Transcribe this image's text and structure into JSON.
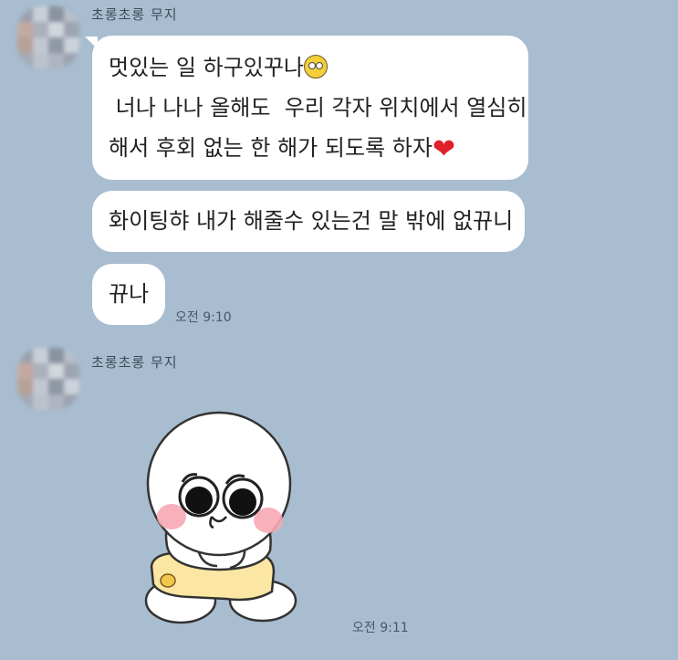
{
  "messages": {
    "group1": {
      "sender": "초롱초롱 무지",
      "bubble1_lines": [
        "멋있는 일 하구있꾸나",
        " 너나 나나 올해도  우리 각자 위치에서 열심히",
        "해서 후회 없는 한 해가 되도록 하자"
      ],
      "bubble2": "화이팅햐 내가 해줄수 있는건 말 밖에 없뀨니",
      "bubble3": "뀨나",
      "time": "오전 9:10"
    },
    "group2": {
      "sender": "초롱초롱 무지",
      "time": "오전 9:11"
    }
  },
  "icons": {
    "emoji1": "muzi-face-emoticon",
    "emoji2": "red-heart",
    "sticker": "white-character-sticker"
  },
  "colors": {
    "background": "#a8bdd0",
    "bubble": "#ffffff",
    "heart": "#e0202a"
  }
}
